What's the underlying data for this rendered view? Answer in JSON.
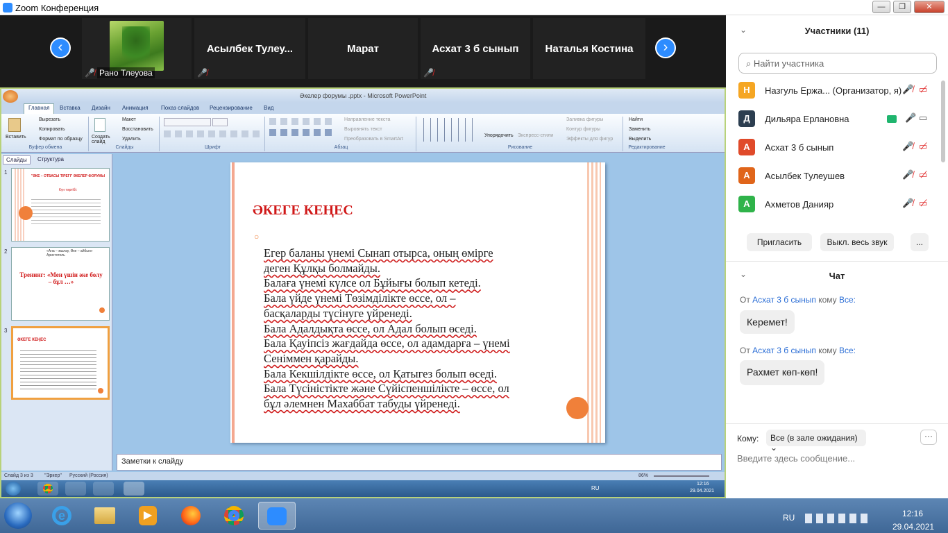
{
  "window": {
    "title": "Zoom Конференция",
    "min": "—",
    "max": "❐",
    "close": "✕"
  },
  "strip": {
    "participants": [
      {
        "name": "Рано Тлеуова",
        "muted": true,
        "has_video": true
      },
      {
        "name": "Асылбек  Тулеу...",
        "muted": true
      },
      {
        "name": "Марат",
        "muted": false
      },
      {
        "name": "Асхат 3 б сынып",
        "muted": true
      },
      {
        "name": "Наталья Костина",
        "muted": false
      }
    ],
    "prev_icon": "‹",
    "next_icon": "›"
  },
  "ppt": {
    "title": "Әкелер форумы .pptx - Microsoft PowerPoint",
    "tabs": [
      "Главная",
      "Вставка",
      "Дизайн",
      "Анимация",
      "Показ слайдов",
      "Рецензирование",
      "Вид"
    ],
    "groups": {
      "clipboard": {
        "label": "Буфер обмена",
        "paste": "Вставить",
        "cut": "Вырезать",
        "copy": "Копировать",
        "format": "Формат по образцу"
      },
      "slides": {
        "label": "Слайды",
        "new": "Создать слайд",
        "layout": "Макет",
        "reset": "Восстановить",
        "delete": "Удалить"
      },
      "font": {
        "label": "Шрифт"
      },
      "paragraph": {
        "label": "Абзац",
        "dir": "Направление текста",
        "align": "Выровнять текст",
        "smartart": "Преобразовать в SmartArt"
      },
      "drawing": {
        "label": "Рисование",
        "arrange": "Упорядочить",
        "styles": "Экспресс-стили",
        "fill": "Заливка фигуры",
        "outline": "Контур фигуры",
        "effects": "Эффекты для фигур"
      },
      "editing": {
        "label": "Редактирование",
        "find": "Найти",
        "replace": "Заменить",
        "select": "Выделить"
      }
    },
    "pane_tabs": [
      "Слайды",
      "Структура"
    ],
    "thumbs": [
      {
        "num": "1",
        "title": "\"ӘКЕ – ОТБАСЫ ТІРЕГІ\" ӘКЕЛЕР ФОРУМЫ",
        "sub": "Күн тәртібі:"
      },
      {
        "num": "2",
        "quote": "«Ана – жылау, Әке – айбын»  Аристотель",
        "title": "Тренинг: «Мен үшін әке болу – бұл …»"
      },
      {
        "num": "3",
        "title": "ӘКЕГЕ КЕҢЕС"
      }
    ],
    "slide": {
      "title": "ӘКЕГЕ КЕҢЕС",
      "bullet": "○",
      "lines": [
        "Егер баланы үнемі Сынап отырса, оның өмірге",
        "деген Құлқы болмайды.",
        "Балаға үнемі күлсе ол Бұйығы болып кетеді.",
        "Бала үйде үнемі Төзімділікте өссе, ол –",
        "басқаларды түсінуге үйренеді.",
        "Бала Адалдықта өссе, ол Адал болып өседі.",
        "Бала Қауіпсіз жағдайда өссе, ол адамдарға – үнемі",
        "Сеніммен қарайды.",
        "Бала Кекшілдікте өссе, ол Қатыгез болып өседі.",
        "Бала Түсіністікте және Сүйіспеншілікте – өссе, ол",
        "бұл әлемнен Махаббат табуды үйренеді."
      ]
    },
    "notes": "Заметки к слайду",
    "status": {
      "slide": "Слайд 3 из 3",
      "theme": "\"Эркер\"",
      "lang": "Русский (Россия)",
      "zoom": "86%"
    },
    "inner_clock": {
      "time": "12:16",
      "date": "29.04.2021"
    },
    "inner_lang": "RU"
  },
  "panel": {
    "participants_title": "Участники (11)",
    "search_placeholder": "Найти участника",
    "participants": [
      {
        "initial": "Н",
        "name": "Назгуль Ержа... (Организатор, я)",
        "color": "#f5a623"
      },
      {
        "initial": "Д",
        "name": "Дильяра Ерлановна",
        "color": "#2c3e50"
      },
      {
        "initial": "А",
        "name": "Асхат 3 б сынып",
        "color": "#e04a2a"
      },
      {
        "initial": "А",
        "name": "Асылбек Тулеушев",
        "color": "#e0651a"
      },
      {
        "initial": "А",
        "name": "Ахметов Данияр",
        "color": "#2fb34a"
      }
    ],
    "invite": "Пригласить",
    "mute_all": "Выкл. весь звук",
    "more": "...",
    "chat_title": "Чат",
    "messages": [
      {
        "from": "От ",
        "sender": "Асхат 3 б сынып",
        "to_word": " кому ",
        "to": "Все:",
        "text": "Керемет!"
      },
      {
        "from": "От ",
        "sender": "Асхат 3 б сынып",
        "to_word": " кому ",
        "to": "Все:",
        "text": "Рахмет көп-көп!"
      }
    ],
    "to_label": "Кому:",
    "to_value": "Все (в зале ожидания)",
    "compose_placeholder": "Введите здесь сообщение..."
  },
  "taskbar": {
    "lang": "RU",
    "time": "12:16",
    "date": "29.04.2021"
  }
}
